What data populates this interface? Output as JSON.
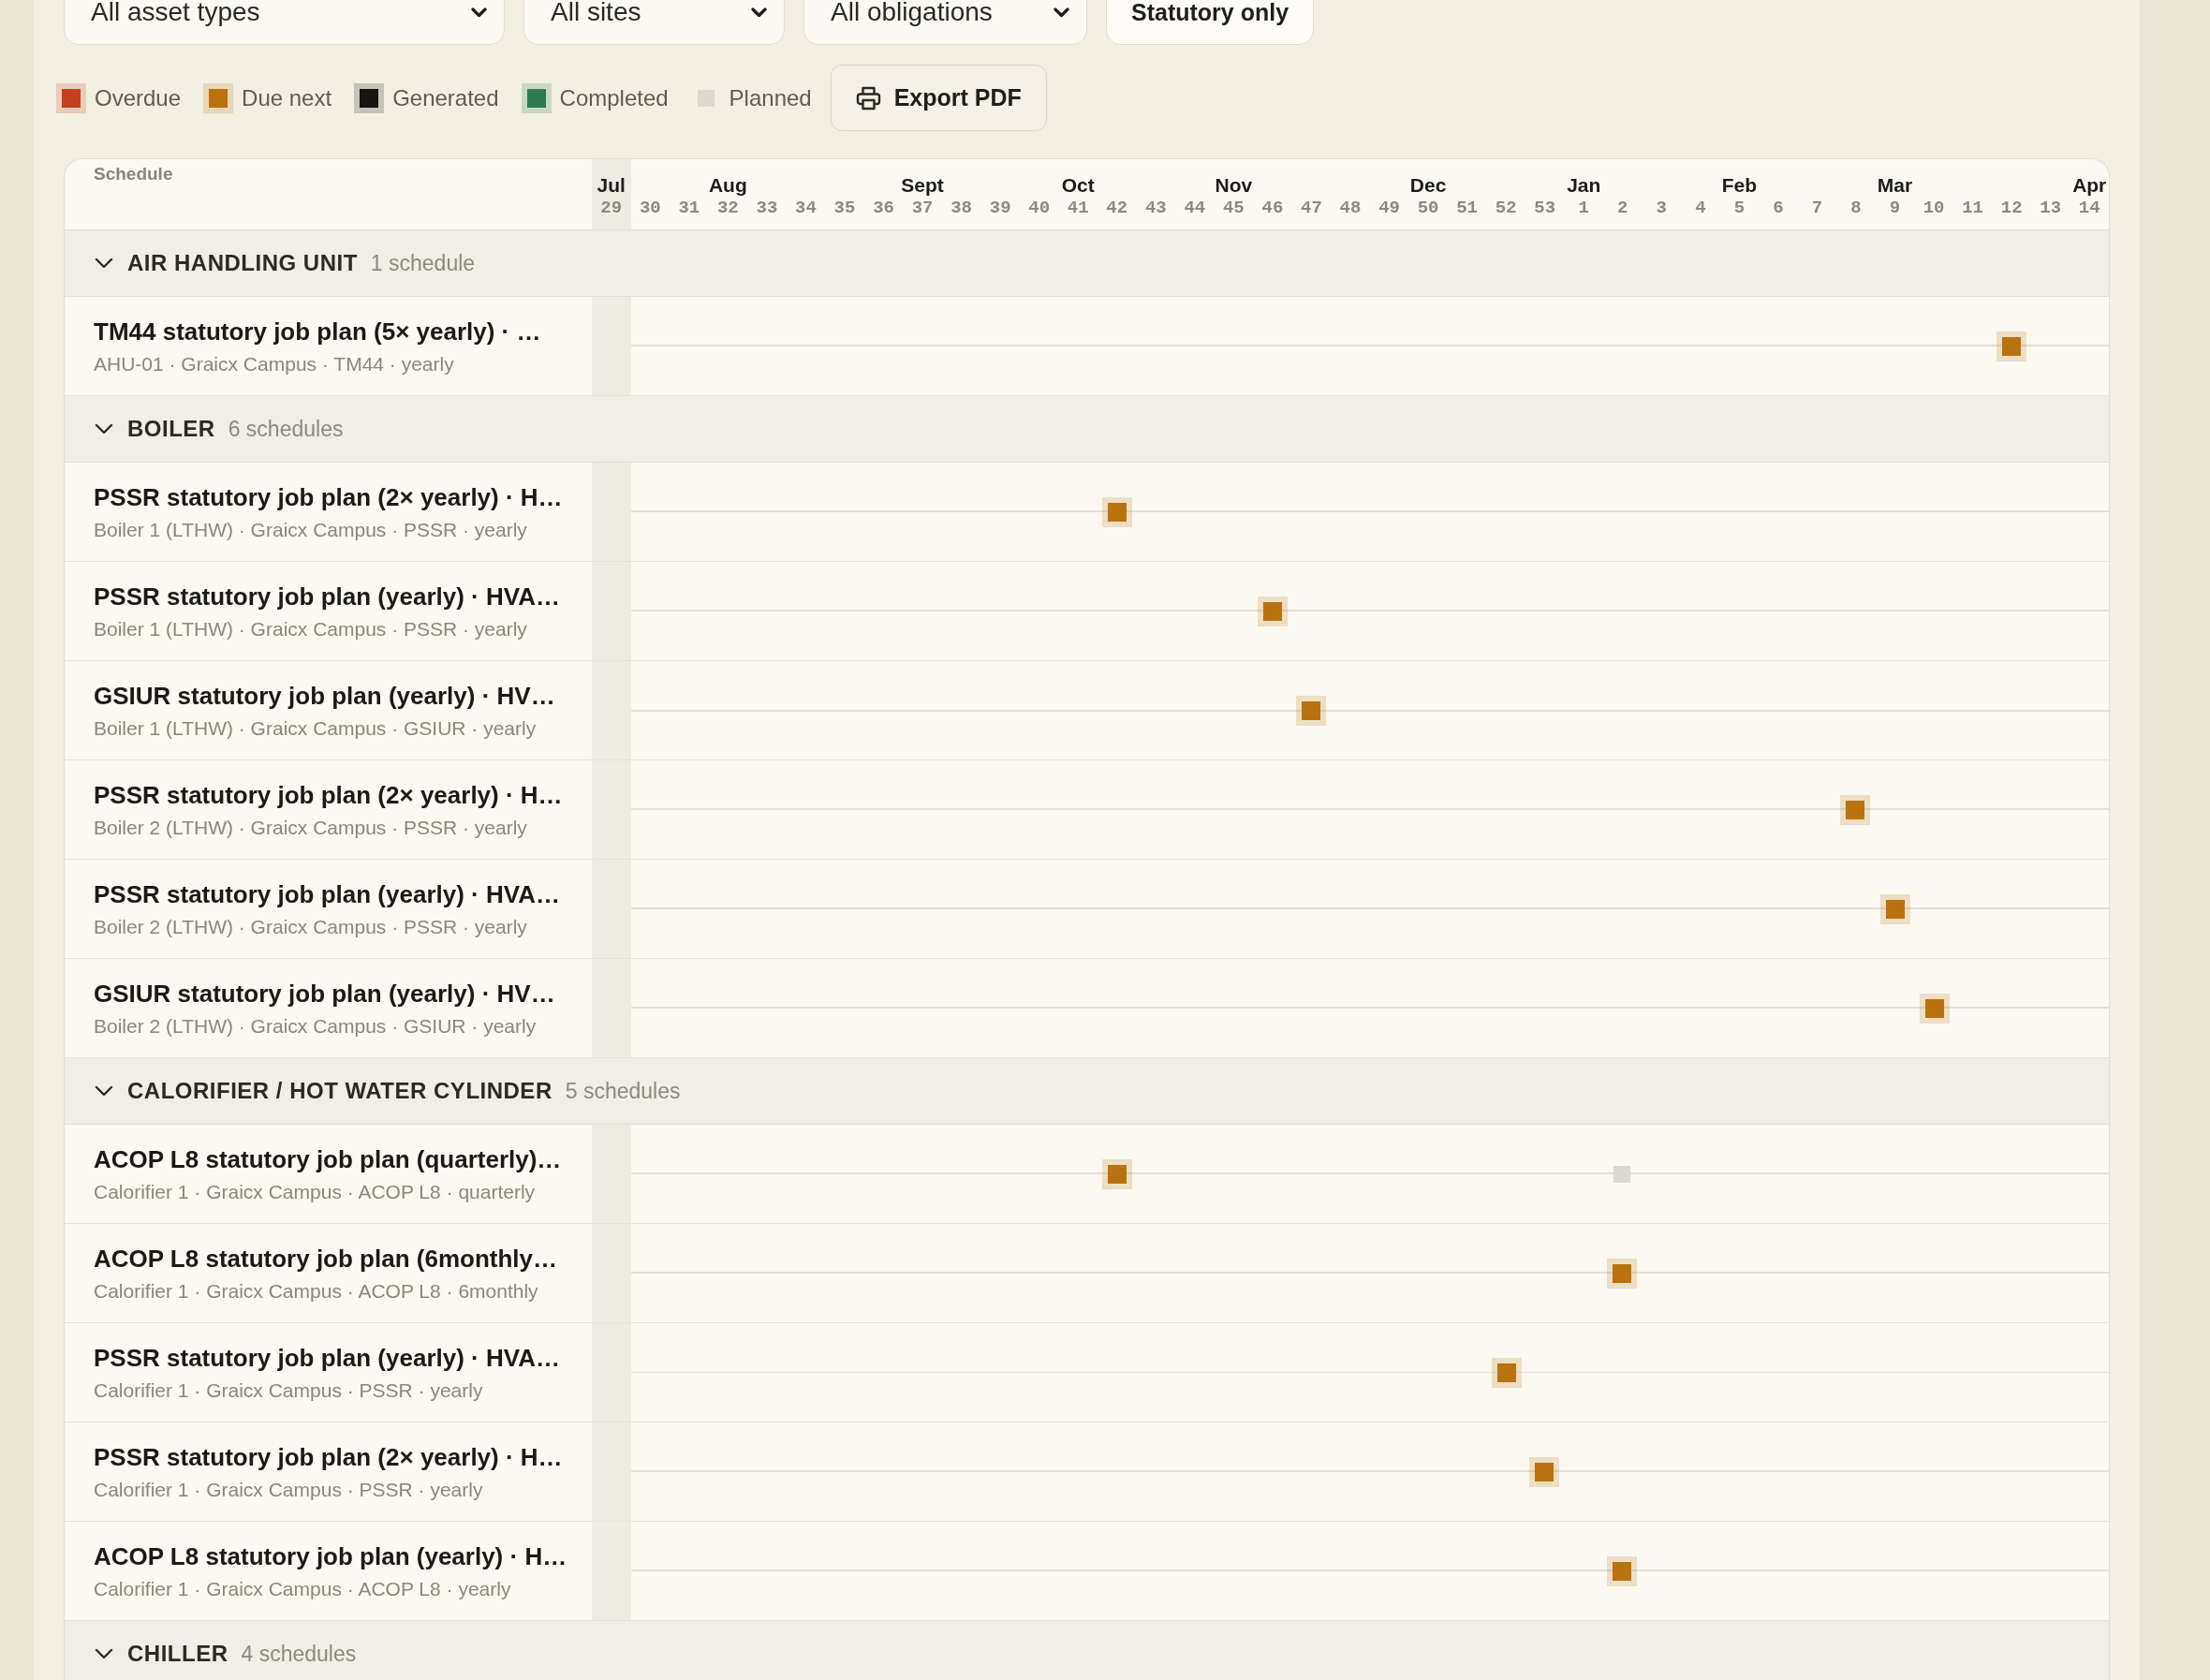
{
  "filters": [
    {
      "kind": "dropdown",
      "value": "All asset types"
    },
    {
      "kind": "dropdown",
      "value": "All sites"
    },
    {
      "kind": "dropdown",
      "value": "All obligations"
    },
    {
      "kind": "toggle",
      "label": "Statutory only"
    }
  ],
  "legend": [
    {
      "label": "Overdue",
      "kind": "haloed",
      "color": "#c5401e"
    },
    {
      "label": "Due next",
      "kind": "haloed",
      "color": "#b8730f"
    },
    {
      "label": "Generated",
      "kind": "haloed",
      "color": "#161513"
    },
    {
      "label": "Completed",
      "kind": "haloed",
      "color": "#2e7a4e"
    },
    {
      "label": "Planned",
      "kind": "plain",
      "color": "#dcd9d0"
    }
  ],
  "export_button": {
    "label": "Export PDF"
  },
  "timeline": {
    "heading": "Schedule",
    "weeks": [
      {
        "week": "29",
        "month": "Jul",
        "current": true
      },
      {
        "week": "30",
        "current": false
      },
      {
        "week": "31",
        "current": false
      },
      {
        "week": "32",
        "month": "Aug",
        "current": false
      },
      {
        "week": "33",
        "current": false
      },
      {
        "week": "34",
        "current": false
      },
      {
        "week": "35",
        "current": false
      },
      {
        "week": "36",
        "current": false
      },
      {
        "week": "37",
        "month": "Sept",
        "current": false
      },
      {
        "week": "38",
        "current": false
      },
      {
        "week": "39",
        "current": false
      },
      {
        "week": "40",
        "current": false
      },
      {
        "week": "41",
        "month": "Oct",
        "current": false
      },
      {
        "week": "42",
        "current": false
      },
      {
        "week": "43",
        "current": false
      },
      {
        "week": "44",
        "current": false
      },
      {
        "week": "45",
        "month": "Nov",
        "current": false
      },
      {
        "week": "46",
        "current": false
      },
      {
        "week": "47",
        "current": false
      },
      {
        "week": "48",
        "current": false
      },
      {
        "week": "49",
        "current": false
      },
      {
        "week": "50",
        "month": "Dec",
        "current": false
      },
      {
        "week": "51",
        "current": false
      },
      {
        "week": "52",
        "current": false
      },
      {
        "week": "53",
        "current": false
      },
      {
        "week": "1",
        "month": "Jan",
        "current": false
      },
      {
        "week": "2",
        "current": false
      },
      {
        "week": "3",
        "current": false
      },
      {
        "week": "4",
        "current": false
      },
      {
        "week": "5",
        "month": "Feb",
        "current": false
      },
      {
        "week": "6",
        "current": false
      },
      {
        "week": "7",
        "current": false
      },
      {
        "week": "8",
        "current": false
      },
      {
        "week": "9",
        "month": "Mar",
        "current": false
      },
      {
        "week": "10",
        "current": false
      },
      {
        "week": "11",
        "current": false
      },
      {
        "week": "12",
        "current": false
      },
      {
        "week": "13",
        "current": false
      },
      {
        "week": "14",
        "month": "Apr",
        "current": false
      }
    ]
  },
  "groups": [
    {
      "name": "AIR HANDLING UNIT",
      "count": "1 schedule",
      "expanded": true,
      "rows": [
        {
          "title": "TM44 statutory job plan (5× yearly) · …",
          "subtitle": "AHU-01 · Graicx Campus · TM44 · yearly",
          "events": [
            {
              "level": 0.936,
              "kind": "haloed",
              "color": "#b8730f"
            }
          ]
        }
      ]
    },
    {
      "name": "BOILER",
      "count": "6 schedules",
      "expanded": true,
      "rows": [
        {
          "title": "PSSR statutory job plan (2× yearly) · H…",
          "subtitle": "Boiler 1 (LTHW) · Graicx Campus · PSSR · yearly",
          "events": [
            {
              "level": 0.346,
              "kind": "haloed",
              "color": "#b8730f"
            }
          ]
        },
        {
          "title": "PSSR statutory job plan (yearly) · HVA…",
          "subtitle": "Boiler 1 (LTHW) · Graicx Campus · PSSR · yearly",
          "events": [
            {
              "level": 0.449,
              "kind": "haloed",
              "color": "#b8730f"
            }
          ]
        },
        {
          "title": "GSIUR statutory job plan (yearly) · HV…",
          "subtitle": "Boiler 1 (LTHW) · Graicx Campus · GSIUR · yearly",
          "events": [
            {
              "level": 0.474,
              "kind": "haloed",
              "color": "#b8730f"
            }
          ]
        },
        {
          "title": "PSSR statutory job plan (2× yearly) · H…",
          "subtitle": "Boiler 2 (LTHW) · Graicx Campus · PSSR · yearly",
          "events": [
            {
              "level": 0.833,
              "kind": "haloed",
              "color": "#b8730f"
            }
          ]
        },
        {
          "title": "PSSR statutory job plan (yearly) · HVA…",
          "subtitle": "Boiler 2 (LTHW) · Graicx Campus · PSSR · yearly",
          "events": [
            {
              "level": 0.859,
              "kind": "haloed",
              "color": "#b8730f"
            }
          ]
        },
        {
          "title": "GSIUR statutory job plan (yearly) · HV…",
          "subtitle": "Boiler 2 (LTHW) · Graicx Campus · GSIUR · yearly",
          "events": [
            {
              "level": 0.885,
              "kind": "haloed",
              "color": "#b8730f"
            }
          ]
        }
      ]
    },
    {
      "name": "CALORIFIER / HOT WATER CYLINDER",
      "count": "5 schedules",
      "expanded": true,
      "rows": [
        {
          "title": "ACOP L8 statutory job plan (quarterly)…",
          "subtitle": "Calorifier 1 · Graicx Campus · ACOP L8 · quarterly",
          "events": [
            {
              "level": 0.346,
              "kind": "haloed",
              "color": "#b8730f"
            },
            {
              "level": 0.679,
              "kind": "plain",
              "color": "#dcd9d0"
            }
          ]
        },
        {
          "title": "ACOP L8 statutory job plan (6monthly…",
          "subtitle": "Calorifier 1 · Graicx Campus · ACOP L8 · 6monthly",
          "events": [
            {
              "level": 0.679,
              "kind": "haloed",
              "color": "#b8730f"
            }
          ]
        },
        {
          "title": "PSSR statutory job plan (yearly) · HVA…",
          "subtitle": "Calorifier 1 · Graicx Campus · PSSR · yearly",
          "events": [
            {
              "level": 0.603,
              "kind": "haloed",
              "color": "#b8730f"
            }
          ]
        },
        {
          "title": "PSSR statutory job plan (2× yearly) · H…",
          "subtitle": "Calorifier 1 · Graicx Campus · PSSR · yearly",
          "events": [
            {
              "level": 0.628,
              "kind": "haloed",
              "color": "#b8730f"
            }
          ]
        },
        {
          "title": "ACOP L8 statutory job plan (yearly) · H…",
          "subtitle": "Calorifier 1 · Graicx Campus · ACOP L8 · yearly",
          "events": [
            {
              "level": 0.679,
              "kind": "haloed",
              "color": "#b8730f"
            }
          ]
        }
      ]
    },
    {
      "name": "CHILLER",
      "count": "4 schedules",
      "expanded": true
    }
  ]
}
